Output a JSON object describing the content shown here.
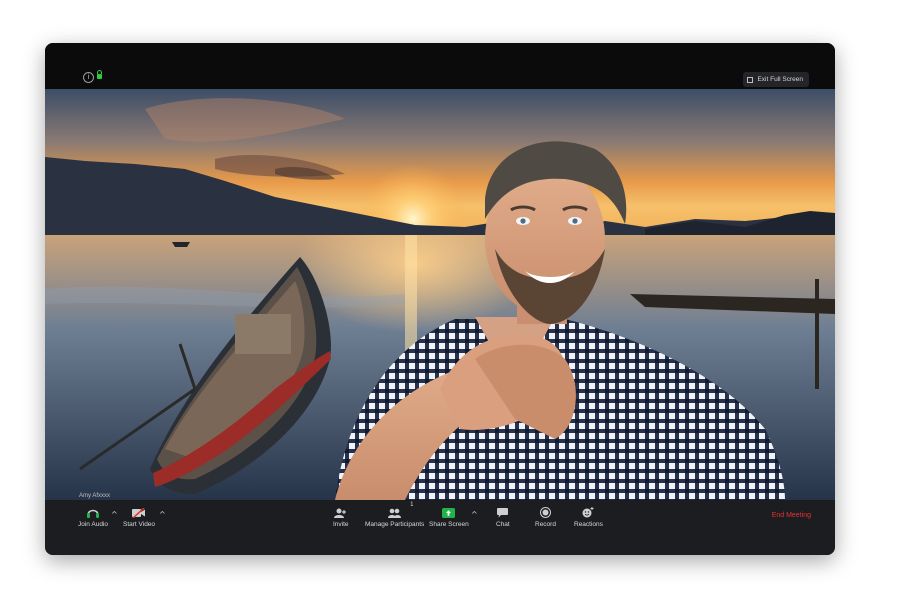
{
  "window": {
    "exit_full_screen_label": "Exit Full Screen",
    "info_icon": "info-icon",
    "security_icon": "lock-icon"
  },
  "participant": {
    "name_label": "Amy Afxxxx"
  },
  "toolbar": {
    "join_audio": "Join Audio",
    "start_video": "Start Video",
    "invite": "Invite",
    "manage_participants": "Manage Participants",
    "participant_count": "1",
    "share_screen": "Share Screen",
    "chat": "Chat",
    "record": "Record",
    "reactions": "Reactions",
    "end_meeting": "End Meeting",
    "caret": "^"
  },
  "colors": {
    "share_green": "#22b24c",
    "end_red": "#e5322d",
    "toolbar_bg": "#1c1d20"
  }
}
